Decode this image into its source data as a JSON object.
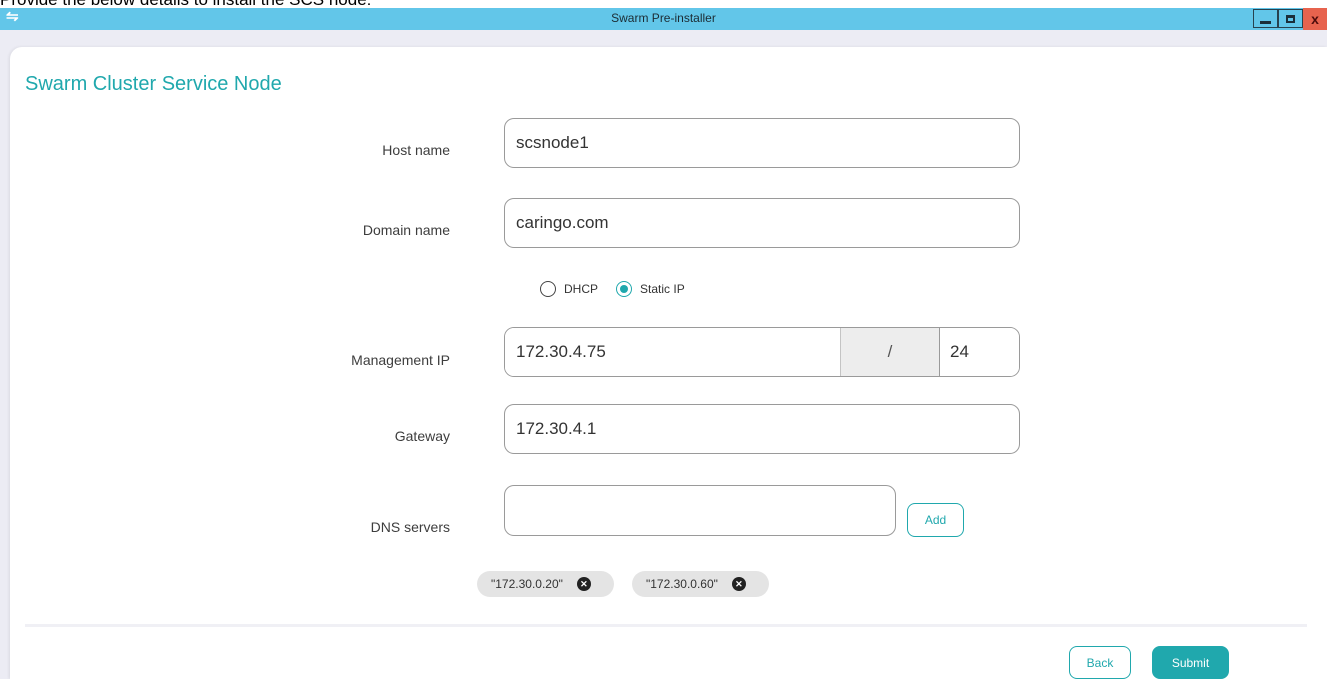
{
  "caption": "Provide the below details to install the SCS node:",
  "window": {
    "title": "Swarm Pre-installer",
    "controls": {
      "minimize": "minimize-icon",
      "maximize": "restore-icon",
      "close": "x"
    },
    "colors": {
      "titlebar": "#62c6e9",
      "accent": "#20a8ad",
      "close": "#e7634e"
    }
  },
  "page": {
    "heading": "Swarm Cluster Service Node"
  },
  "form": {
    "host_name": {
      "label": "Host name",
      "value": "scsnode1"
    },
    "domain_name": {
      "label": "Domain name",
      "value": "caringo.com"
    },
    "ip_mode": {
      "options": [
        {
          "label": "DHCP",
          "selected": false
        },
        {
          "label": "Static IP",
          "selected": true
        }
      ]
    },
    "management_ip": {
      "label": "Management IP",
      "value": "172.30.4.75",
      "separator": "/",
      "prefix": "24"
    },
    "gateway": {
      "label": "Gateway",
      "value": "172.30.4.1"
    },
    "dns": {
      "label": "DNS servers",
      "value": "",
      "add_label": "Add",
      "entries": [
        "\"172.30.0.20\"",
        "\"172.30.0.60\""
      ]
    }
  },
  "footer": {
    "back_label": "Back",
    "submit_label": "Submit"
  }
}
